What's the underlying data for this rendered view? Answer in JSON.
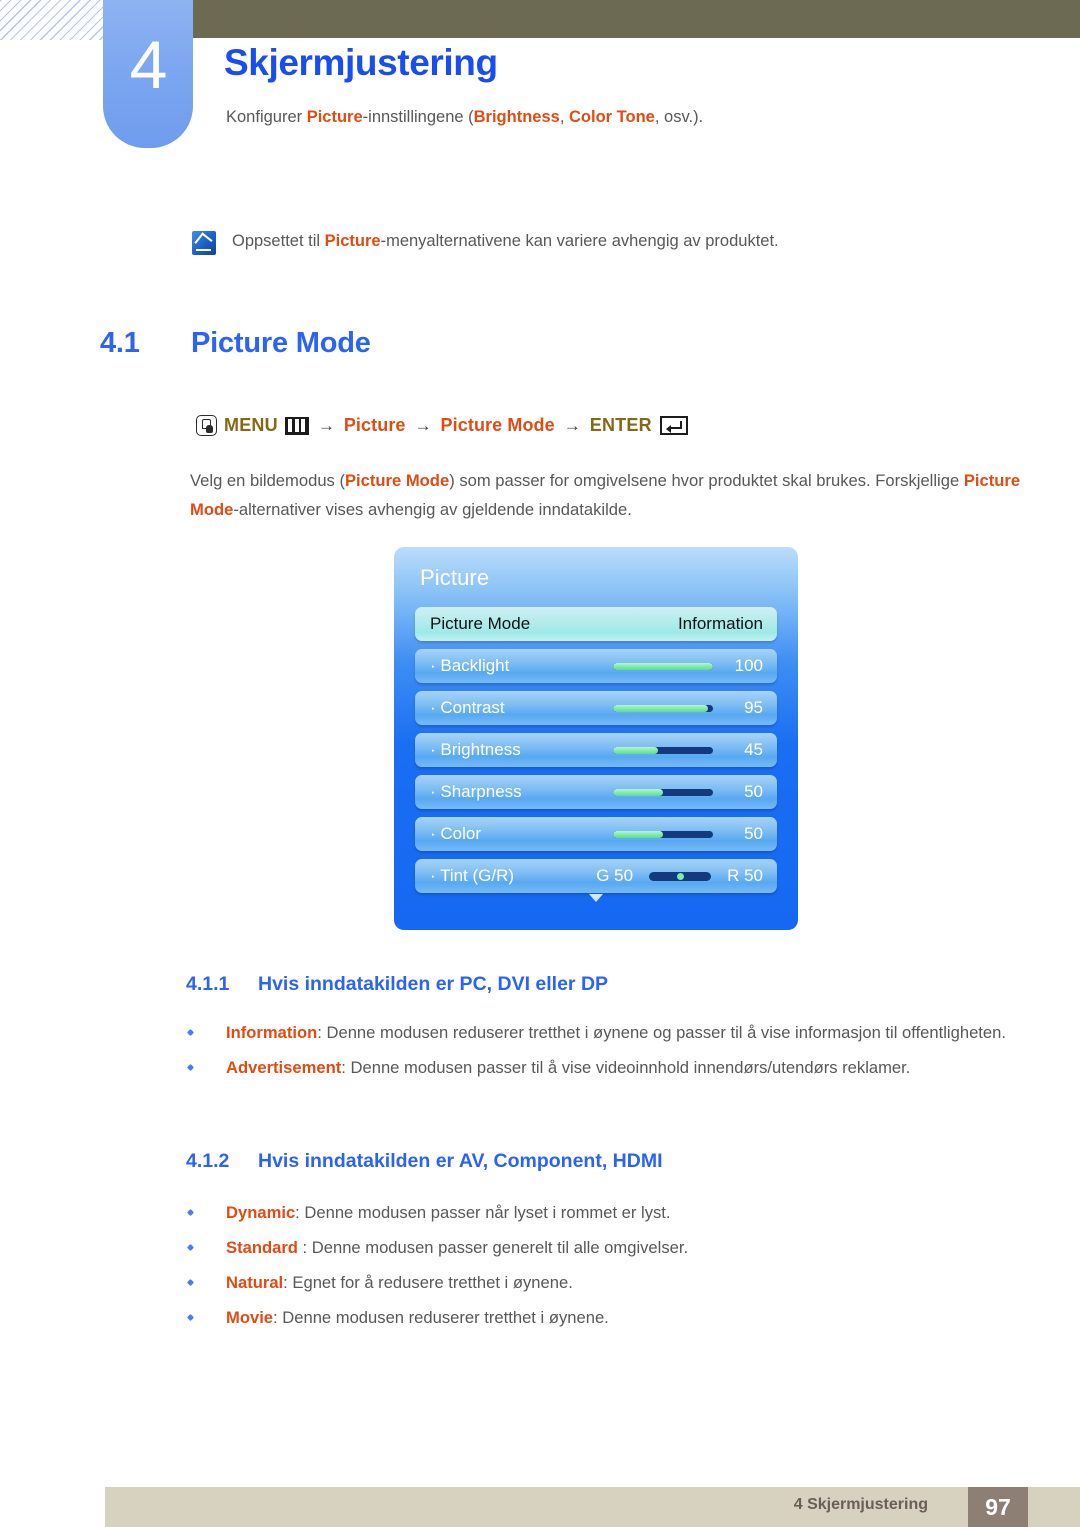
{
  "header": {
    "chapter_number": "4",
    "chapter_title": "Skjermjustering",
    "subtitle_pre": "Konfigurer ",
    "subtitle_kw1": "Picture",
    "subtitle_mid": "-innstillingene (",
    "subtitle_kw2": "Brightness",
    "subtitle_mid2": ", ",
    "subtitle_kw3": "Color Tone",
    "subtitle_end": ", osv.)."
  },
  "note": {
    "icon": "note-pencil-icon",
    "text_pre": "Oppsettet til ",
    "keyword": "Picture",
    "text_post": "-menyalternativene kan variere avhengig av produktet."
  },
  "section": {
    "number": "4.1",
    "title": "Picture Mode"
  },
  "breadcrumb": {
    "press_icon": "press-button-icon",
    "menu_label": "MENU",
    "menu_icon": "menu-bars-icon",
    "arrow": "→",
    "item1": "Picture",
    "item2": "Picture Mode",
    "enter_label": "ENTER",
    "enter_icon": "enter-key-icon"
  },
  "body": {
    "p1_a": "Velg en bildemodus (",
    "p1_kw": "Picture Mode",
    "p1_b": ") som passer for omgivelsene hvor produktet skal brukes. Forskjellige ",
    "p1_kw2": "Picture Mode",
    "p1_c": "-alternativer vises avhengig av gjeldende inndatakilde."
  },
  "osd": {
    "title": "Picture",
    "down_arrow": "chevron-down-icon",
    "rows": [
      {
        "label": "Picture Mode",
        "value": "Information",
        "type": "select",
        "selected": true
      },
      {
        "label": "· Backlight",
        "value": "100",
        "type": "slider",
        "fill_pct": 100,
        "selected": false
      },
      {
        "label": "· Contrast",
        "value": "95",
        "type": "slider",
        "fill_pct": 95,
        "selected": false
      },
      {
        "label": "· Brightness",
        "value": "45",
        "type": "slider",
        "fill_pct": 45,
        "selected": false
      },
      {
        "label": "· Sharpness",
        "value": "50",
        "type": "slider",
        "fill_pct": 50,
        "selected": false
      },
      {
        "label": "· Color",
        "value": "50",
        "type": "slider",
        "fill_pct": 50,
        "selected": false
      },
      {
        "label": "· Tint (G/R)",
        "type": "tint",
        "left_value": "G 50",
        "right_value": "R 50",
        "knob_pct": 50,
        "selected": false
      }
    ]
  },
  "sub1": {
    "number": "4.1.1",
    "title": "Hvis inndatakilden er PC, DVI eller DP",
    "bullets": [
      {
        "term": "Information",
        "rest": ": Denne modusen reduserer tretthet i øynene og passer til å vise informasjon til offentligheten."
      },
      {
        "term": "Advertisement",
        "rest": ": Denne modusen passer til å vise videoinnhold innendørs/utendørs reklamer."
      }
    ]
  },
  "sub2": {
    "number": "4.1.2",
    "title": "Hvis inndatakilden er AV, Component, HDMI",
    "bullets": [
      {
        "term": "Dynamic",
        "rest": ": Denne modusen passer når lyset i rommet er lyst."
      },
      {
        "term": "Standard",
        "rest": " : Denne modusen passer generelt til alle omgivelser."
      },
      {
        "term": "Natural",
        "rest": ": Egnet for å redusere tretthet i øynene."
      },
      {
        "term": "Movie",
        "rest": ": Denne modusen reduserer tretthet i øynene."
      }
    ]
  },
  "footer": {
    "text": "4 Skjermjustering",
    "page": "97"
  },
  "colors": {
    "accent_blue": "#2a63f5",
    "keyword_orange": "#e24b12",
    "menu_gold": "#846a16",
    "olive_bar": "#6d6a54",
    "footer_bar": "#d7d2bf",
    "footer_page_box": "#8d7f74",
    "osd_blue": "#1668f2",
    "osd_selected": "#b2ecec",
    "slider_green": "#7eeaad",
    "slider_track": "#123a7c",
    "body_text": "#58585a"
  }
}
